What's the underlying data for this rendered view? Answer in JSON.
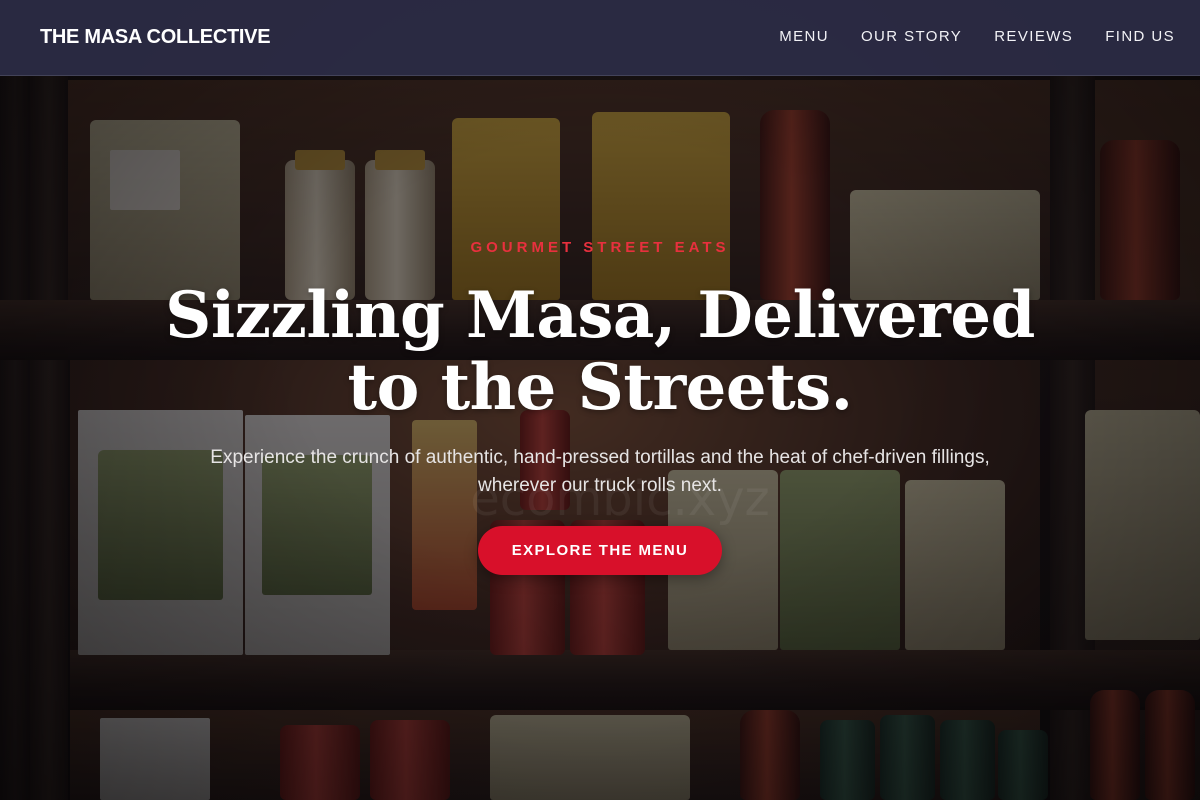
{
  "nav": {
    "brand": "THE MASA COLLECTIVE",
    "links": [
      {
        "label": "MENU"
      },
      {
        "label": "OUR STORY"
      },
      {
        "label": "REVIEWS"
      },
      {
        "label": "FIND US"
      }
    ]
  },
  "hero": {
    "eyebrow": "GOURMET STREET EATS",
    "headline_line1": "Sizzling Masa, Delivered",
    "headline_line2": "to the Streets.",
    "subtext": "Experience the crunch of authentic, hand-pressed tortillas and the heat of chef-driven fillings, wherever our truck rolls next.",
    "cta_label": "EXPLORE THE MENU",
    "watermark": "ecombic.xyz"
  },
  "colors": {
    "accent": "#d8102a",
    "eyebrow": "#e8303e",
    "navbar": "#2c2c46"
  }
}
